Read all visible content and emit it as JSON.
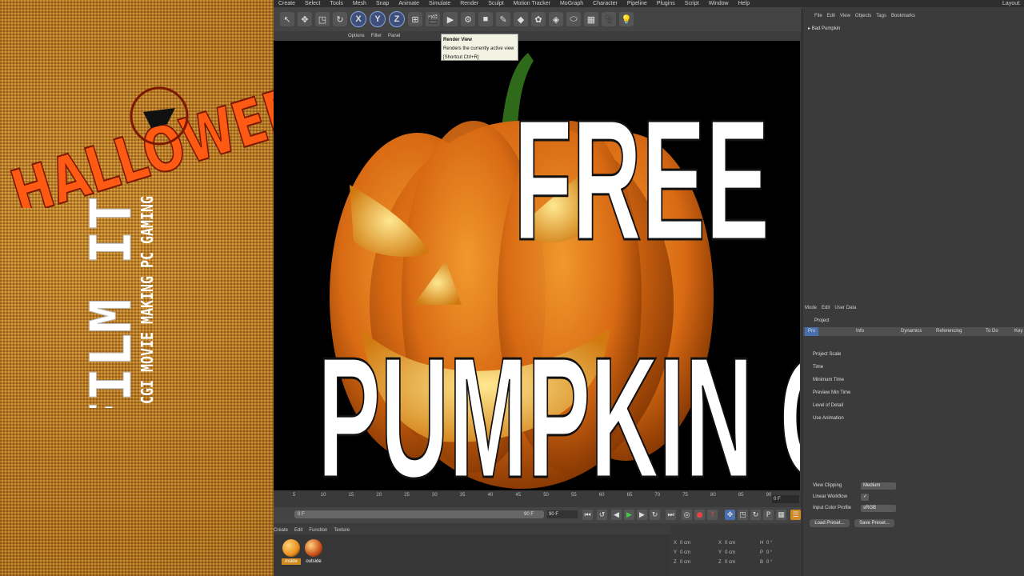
{
  "left_panel": {
    "halloween_title": "HALLOWEEN",
    "channel_name": "FILM IT",
    "channel_tagline": "VFX CGI MOVIE MAKING PC GAMING"
  },
  "menubar": {
    "items": [
      "Create",
      "Select",
      "Tools",
      "Mesh",
      "Snap",
      "Animate",
      "Simulate",
      "Render",
      "Sculpt",
      "Motion Tracker",
      "MoGraph",
      "Character",
      "Pipeline",
      "Plugins",
      "Script",
      "Window",
      "Help"
    ],
    "layout_label": "Layout:"
  },
  "toolbar": {
    "axis_x": "X",
    "axis_y": "Y",
    "axis_z": "Z"
  },
  "tooltip": {
    "title": "Render View",
    "description": "Renders the currently active view",
    "shortcut": "[Shortcut Ctrl+R]"
  },
  "viewport": {
    "menu": [
      "Options",
      "Filter",
      "Panel"
    ],
    "title_line1": "FREE",
    "title_line2": "PUMPKIN OBJ"
  },
  "timeline": {
    "ticks": [
      "5",
      "10",
      "15",
      "20",
      "25",
      "30",
      "35",
      "40",
      "45",
      "50",
      "55",
      "60",
      "65",
      "70",
      "75",
      "80",
      "85",
      "90"
    ],
    "frame_field": "0 F",
    "slider_start": "0 F",
    "slider_end": "90 F",
    "end_frame": "90 F"
  },
  "materials": {
    "menu": [
      "Create",
      "Edit",
      "Function",
      "Texture"
    ],
    "items": [
      {
        "label": "inside",
        "color": "#e8901c"
      },
      {
        "label": "outside",
        "color": "#c8501a"
      }
    ]
  },
  "coords": {
    "rows": [
      {
        "axis": "X",
        "pos": "0 cm",
        "size": "0 cm",
        "rot_label": "H",
        "rot": "0 °"
      },
      {
        "axis": "Y",
        "pos": "0 cm",
        "size": "0 cm",
        "rot_label": "P",
        "rot": "0 °"
      },
      {
        "axis": "Z",
        "pos": "0 cm",
        "size": "0 cm",
        "rot_label": "B",
        "rot": "0 °"
      }
    ]
  },
  "object_manager": {
    "menu": [
      "File",
      "Edit",
      "View",
      "Objects",
      "Tags",
      "Bookmarks"
    ],
    "object": "Bad Pumpkin"
  },
  "attribute_manager": {
    "menu": [
      "Mode",
      "Edit",
      "User Data"
    ],
    "title": "Project",
    "tabs": [
      "Pro",
      "Info",
      "Dynamics",
      "Referencing",
      "To Do",
      "Key"
    ],
    "rows": [
      {
        "label": "Project Scale",
        "value": ""
      },
      {
        "label": "Time",
        "value": ""
      },
      {
        "label": "Minimum Time",
        "value": ""
      },
      {
        "label": "Preview Min Time",
        "value": ""
      },
      {
        "label": "Level of Detail",
        "value": ""
      },
      {
        "label": "Use Animation",
        "value": ""
      },
      {
        "label": "View Clipping",
        "value": "Medium"
      },
      {
        "label": "Linear Workflow",
        "value": "✓"
      },
      {
        "label": "Input Color Profile",
        "value": "sRGB"
      }
    ],
    "buttons": [
      "Load Preset...",
      "Save Preset..."
    ]
  },
  "colors": {
    "accent": "#ff5a14",
    "pumpkin": "#e2731c",
    "stem": "#2f6a1a"
  }
}
